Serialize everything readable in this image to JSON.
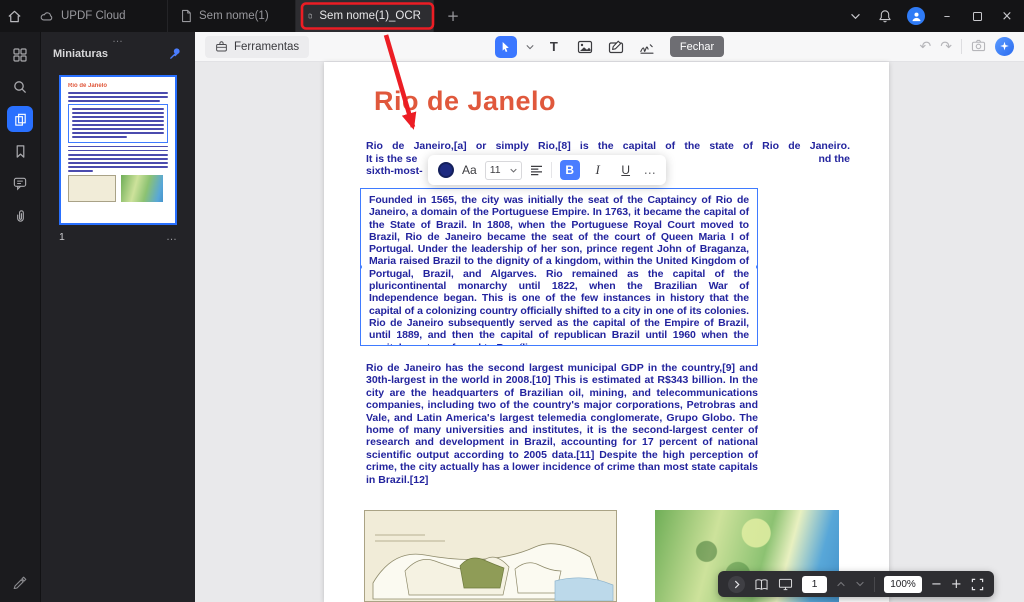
{
  "titlebar": {
    "tabs": [
      {
        "label": "UPDF Cloud"
      },
      {
        "label": "Sem nome(1)"
      },
      {
        "label": "Sem nome(1)_OCR"
      }
    ]
  },
  "sidebar": {
    "panel_title": "Miniaturas",
    "page_number": "1"
  },
  "toolbar": {
    "tools_label": "Ferramentas",
    "close_label": "Fechar"
  },
  "format_bar": {
    "font_label": "Aa",
    "font_size": "11",
    "bold_label": "B",
    "italic_label": "I",
    "underline_label": "U"
  },
  "document": {
    "title": "Rio de Janelo",
    "intro_line1": "Rio de Janeiro,[a] or simply Rio,[8] is the capital of the state of Rio de Janeiro.",
    "intro_line2_left": "It is the se",
    "intro_line2_right": "nd the",
    "intro_line3": "sixth-most-",
    "selected_paragraph": "Founded in 1565, the city was initially the seat of the Captaincy of Rio de Janeiro, a domain of the Portuguese Empire. In 1763, it became the capital of the State of Brazil. In 1808, when the Portuguese Royal Court moved to Brazil, Rio de Janeiro became the seat of the court of Queen Maria I of Portugal. Under the leadership of her son, prince regent John of Braganza, Maria raised Brazil to the dignity of a kingdom, within the United Kingdom of Portugal, Brazil, and Algarves. Rio remained as the capital of the pluricontinental monarchy until 1822, when the Brazilian War of Independence began. This is one of the few instances in history that the capital of a colonizing country officially shifted to a city in one of its colonies. Rio de Janeiro subsequently served as the capital of the Empire of Brazil, until 1889, and then the capital of republican Brazil until 1960 when the capital was transferred to Brasília.",
    "paragraph2": "Rio de Janeiro has the second largest municipal GDP in the country,[9] and 30th-largest in the world in 2008.[10] This is estimated at R$343 billion. In the city are the headquarters of Brazilian oil, mining, and telecommunications companies, including two of the country's major corporations, Petrobras and Vale, and Latin America's largest telemedia conglomerate, Grupo Globo. The home of many universities and institutes, it is the second-largest center of research and development in Brazil, accounting for 17 percent of national scientific output according to 2005 data.[11] Despite the high perception of crime, the city actually has a lower incidence of crime than most state capitals in Brazil.[12]"
  },
  "status_bar": {
    "page_number": "1",
    "zoom_level": "100%"
  },
  "icons": {
    "more_h": "…",
    "plus": "+",
    "minus": "−",
    "minimize": "–",
    "close": "×",
    "undo": "↶",
    "redo": "↷",
    "text_tool": "T"
  },
  "colors": {
    "accent_blue": "#2970ff",
    "text_navy": "#23249e",
    "title_orange": "#e0583c",
    "annotation_red": "#ec1d24"
  }
}
